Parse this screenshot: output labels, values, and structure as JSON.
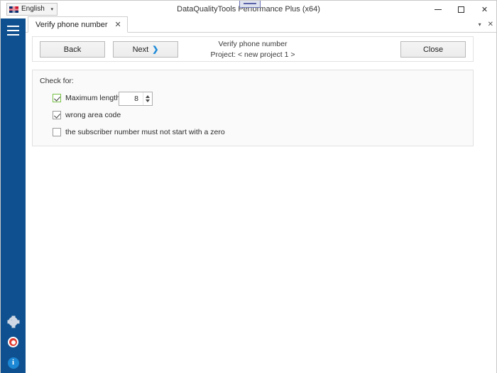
{
  "window": {
    "title": "DataQualityTools Performance Plus (x64)",
    "controls": {
      "minimize": "–",
      "maximize": "□",
      "close": "✕"
    }
  },
  "language_selector": {
    "label": "English",
    "caret": "▾",
    "flag_icon": "union-jack-flag"
  },
  "sidebar": {
    "menu_icon": "hamburger-menu-icon",
    "bottom_icons": [
      {
        "name": "settings-gear-icon",
        "glyph": ""
      },
      {
        "name": "support-lifebuoy-icon",
        "glyph": ""
      },
      {
        "name": "info-icon",
        "glyph": "i"
      }
    ],
    "color": "#0f5190"
  },
  "tabstrip": {
    "tabs": [
      {
        "label": "Verify phone number",
        "close": "✕"
      }
    ],
    "list_caret": "▾",
    "close_all": "✕"
  },
  "toolbar": {
    "back_label": "Back",
    "next_label": "Next",
    "next_chevron": "❯",
    "close_label": "Close",
    "title": "Verify phone number",
    "project": "Project: < new project 1 >"
  },
  "check_panel": {
    "heading": "Check for:",
    "options": [
      {
        "label": "Maximum length",
        "checked": true,
        "highlighted": true
      },
      {
        "label": "wrong area code",
        "checked": true,
        "highlighted": false
      },
      {
        "label": "the subscriber number must not start with a zero",
        "checked": false,
        "highlighted": false
      }
    ],
    "max_length_value": "8"
  },
  "colors": {
    "sidebar": "#0f5190",
    "accent_chevron": "#1e8bd8",
    "checkbox_highlight": "#76c044",
    "info_icon": "#1c87d4",
    "lifebuoy": "#e03a2f"
  }
}
